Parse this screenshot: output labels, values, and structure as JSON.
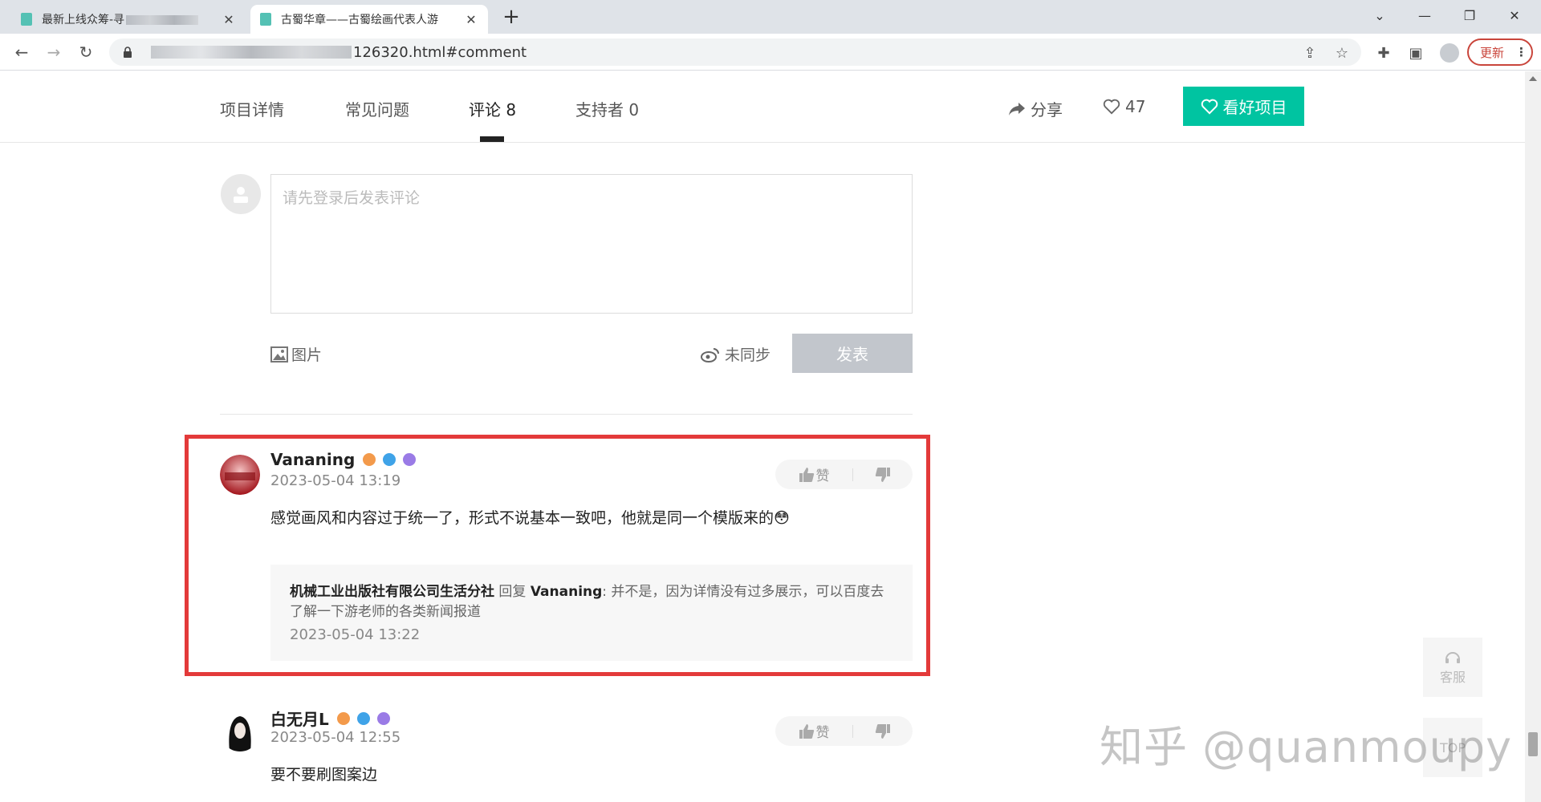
{
  "browser": {
    "tabs": [
      {
        "title": "最新上线众筹-寻",
        "active": false
      },
      {
        "title": "古蜀华章——古蜀绘画代表人游",
        "active": true
      }
    ],
    "url_suffix": "126320.html#comment",
    "update_label": "更新"
  },
  "subnav": {
    "tabs": [
      "项目详情",
      "常见问题",
      "评论 8",
      "支持者 0"
    ],
    "share_label": "分享",
    "like_count": "47",
    "favorite_label": "看好项目"
  },
  "composer": {
    "placeholder": "请先登录后发表评论",
    "image_label": "图片",
    "sync_label": "未同步",
    "post_label": "发表"
  },
  "comments": [
    {
      "username": "Vananing",
      "time": "2023-05-04 13:19",
      "text": "感觉画风和内容过于统一了，形式不说基本一致吧，他就是同一个模版来的😳",
      "like_label": "赞",
      "reply": {
        "author": "机械工业出版社有限公司生活分社",
        "action": " 回复 ",
        "target": "Vananing",
        "text": ": 并不是，因为详情没有过多展示，可以百度去了解一下游老师的各类新闻报道",
        "time": "2023-05-04 13:22"
      }
    },
    {
      "username": "白无月L",
      "time": "2023-05-04 12:55",
      "text": "要不要刷图案边",
      "like_label": "赞"
    }
  ],
  "side": {
    "service_label": "客服",
    "top_label": "TOP"
  },
  "watermark": "知乎 @quanmoupy",
  "colors": {
    "accent": "#00c4a1",
    "highlight": "#e33a3a",
    "update": "#c9453b"
  }
}
